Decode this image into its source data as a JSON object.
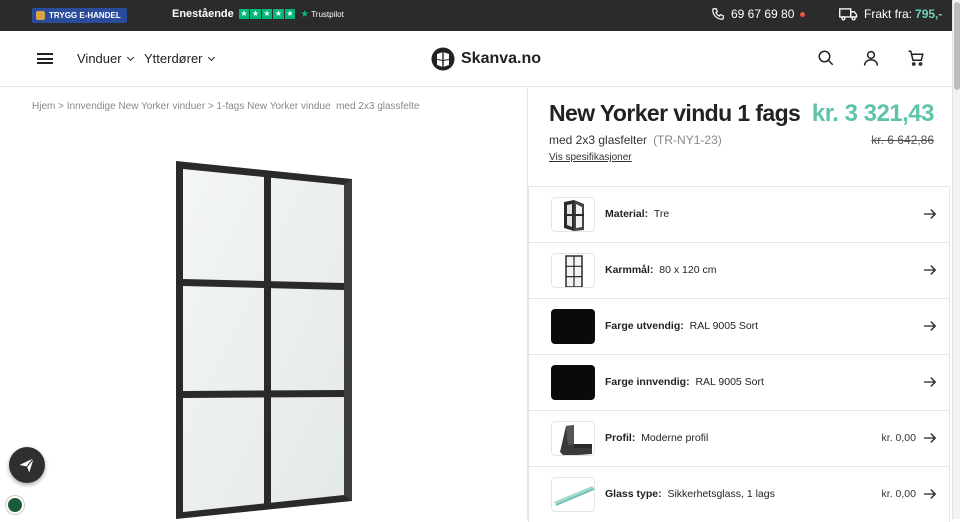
{
  "topbar": {
    "badge_text": "TRYGG E-HANDEL",
    "rating_text": "Enestående",
    "trustpilot_text": "Trustpilot",
    "phone": "69 67 69 80",
    "freight_label": "Frakt fra:",
    "freight_value": "795,-"
  },
  "header": {
    "nav": [
      {
        "label": "Vinduer"
      },
      {
        "label": "Ytterdører"
      }
    ],
    "logo_text": "Skanva.no"
  },
  "breadcrumb": "Hjem > Innvendige New Yorker vinduer > 1-fags New Yorker vindue  med 2x3 glassfelte",
  "product": {
    "title": "New Yorker vindu 1 fags",
    "price": "kr. 3 321,43",
    "subtitle": "med 2x3 glasfelter",
    "sku": "(TR-NY1-23)",
    "old_price": "kr. 6 642,86",
    "spec_link": "Vis spesifikasjoner"
  },
  "options": [
    {
      "label": "Material:",
      "value": "Tre",
      "price": "",
      "thumb": "frame-angle-icon"
    },
    {
      "label": "Karmmål:",
      "value": "80 x 120 cm",
      "price": "",
      "thumb": "window-grid-icon"
    },
    {
      "label": "Farge utvendig:",
      "value": "RAL 9005 Sort",
      "price": "",
      "thumb": "black-swatch"
    },
    {
      "label": "Farge innvendig:",
      "value": "RAL 9005 Sort",
      "price": "",
      "thumb": "black-swatch"
    },
    {
      "label": "Profil:",
      "value": "Moderne profil",
      "price": "kr. 0,00",
      "thumb": "profile-icon"
    },
    {
      "label": "Glass type:",
      "value": "Sikkerhetsglass, 1 lags",
      "price": "kr. 0,00",
      "thumb": "glass-icon"
    }
  ],
  "colors": {
    "accent": "#5ec3a8",
    "topbar": "#2b2b2b",
    "trustpilot": "#00b67a"
  }
}
